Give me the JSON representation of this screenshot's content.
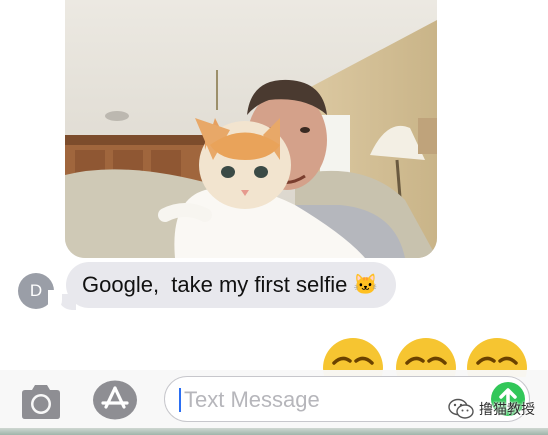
{
  "conversation": {
    "photo_message": {
      "description_icon": "selfie-photo"
    },
    "incoming_message": {
      "sender_initial": "D",
      "text": "Google,  take my first selfie",
      "emoji": "🐱"
    },
    "emoji_message": {
      "emojis": [
        "😌",
        "😌",
        "😌"
      ]
    }
  },
  "compose": {
    "placeholder": "Text Message",
    "camera_icon": "camera-icon",
    "apps_icon": "app-store-icon",
    "send_icon": "send-arrow-icon"
  },
  "watermark": {
    "text": "撸猫教授",
    "icon": "wechat-icon"
  },
  "colors": {
    "bubble_gray": "#e8e8ed",
    "send_green": "#32c759",
    "placeholder_gray": "#b6b6bb"
  }
}
